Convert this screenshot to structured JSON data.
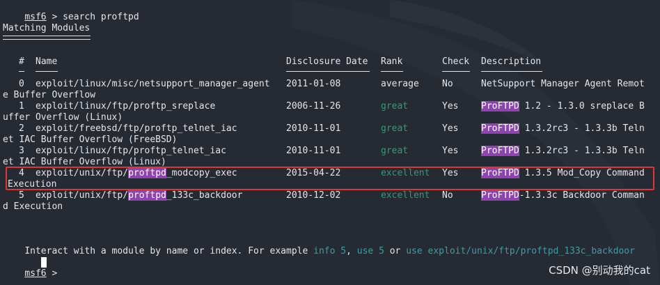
{
  "colors": {
    "background": "#252a33",
    "text": "#e6e6e6",
    "highlight": "#8e44ad",
    "rank_green": "#2e9e78",
    "link_cyan": "#3aa0a3",
    "selection_box": "#e0343b"
  },
  "prompt": {
    "name": "msf6",
    "separator": " > ",
    "command": "search proftpd"
  },
  "section_title": "Matching Modules",
  "table": {
    "headers": {
      "index": "#",
      "name": "Name",
      "disclosure_date": "Disclosure Date",
      "rank": "Rank",
      "check": "Check",
      "description": "Description"
    },
    "rows": [
      {
        "index": "0",
        "name_pre": "exploit/linux/misc/netsupport_manager_agent",
        "name_hl": "",
        "name_post": "",
        "wrap_name": "e Buffer Overflow",
        "date": "2011-01-08",
        "rank": "average",
        "check": "No",
        "desc_hl": "",
        "desc": "NetSupport Manager Agent Remot"
      },
      {
        "index": "1",
        "name_pre": "exploit/linux/ftp/proftp_sreplace",
        "name_hl": "",
        "name_post": "",
        "wrap_name": "uffer Overflow (Linux)",
        "date": "2006-11-26",
        "rank": "great",
        "check": "Yes",
        "desc_hl": "ProFTPD",
        "desc": " 1.2 - 1.3.0 sreplace B"
      },
      {
        "index": "2",
        "name_pre": "exploit/freebsd/ftp/proftp_telnet_iac",
        "name_hl": "",
        "name_post": "",
        "wrap_name": "et IAC Buffer Overflow (FreeBSD)",
        "date": "2010-11-01",
        "rank": "great",
        "check": "Yes",
        "desc_hl": "ProFTPD",
        "desc": " 1.3.2rc3 - 1.3.3b Teln"
      },
      {
        "index": "3",
        "name_pre": "exploit/linux/ftp/proftp_telnet_iac",
        "name_hl": "",
        "name_post": "",
        "wrap_name": "et IAC Buffer Overflow (Linux)",
        "date": "2010-11-01",
        "rank": "great",
        "check": "Yes",
        "desc_hl": "ProFTPD",
        "desc": " 1.3.2rc3 - 1.3.3b Teln"
      },
      {
        "index": "4",
        "name_pre": "exploit/unix/ftp/",
        "name_hl": "proftpd",
        "name_post": "_modcopy_exec",
        "wrap_name": "Execution",
        "date": "2015-04-22",
        "rank": "excellent",
        "check": "Yes",
        "desc_hl": "ProFTPD",
        "desc": " 1.3.5 Mod_Copy Command"
      },
      {
        "index": "5",
        "name_pre": "exploit/unix/ftp/",
        "name_hl": "proftpd",
        "name_post": "_133c_backdoor",
        "wrap_name": "d Execution",
        "date": "2010-12-02",
        "rank": "excellent",
        "check": "No",
        "desc_hl": "ProFTPD",
        "desc": "-1.3.3c Backdoor Comman"
      }
    ]
  },
  "interact_hint": {
    "prefix": "Interact with a module by name or index. For example ",
    "example1": "info 5",
    "sep1": ", ",
    "example2": "use 5",
    "sep2": " or ",
    "example3": "use exploit/unix/ftp/proftpd_133c_backdoor"
  },
  "watermark": "CSDN @别动我的cat"
}
